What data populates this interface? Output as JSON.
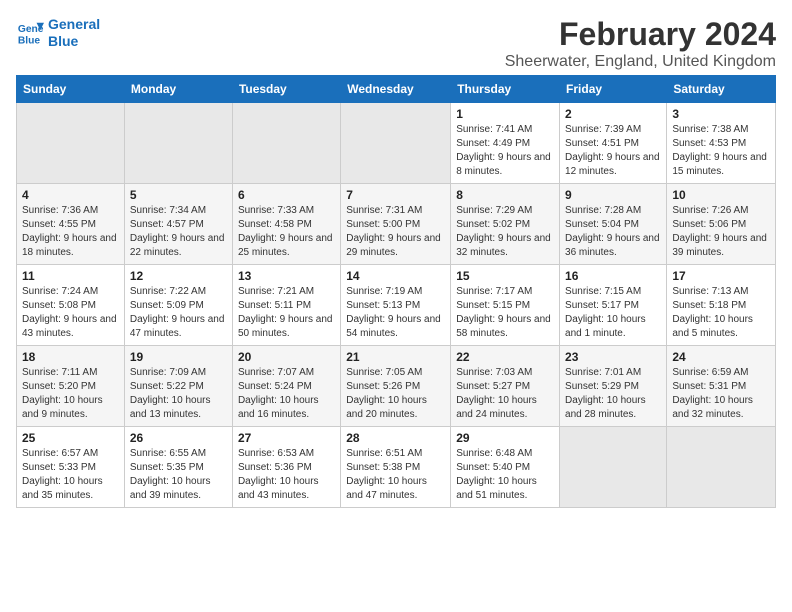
{
  "logo": {
    "line1": "General",
    "line2": "Blue"
  },
  "title": "February 2024",
  "location": "Sheerwater, England, United Kingdom",
  "header": {
    "days": [
      "Sunday",
      "Monday",
      "Tuesday",
      "Wednesday",
      "Thursday",
      "Friday",
      "Saturday"
    ]
  },
  "weeks": [
    [
      {
        "day": "",
        "sunrise": "",
        "sunset": "",
        "daylight": ""
      },
      {
        "day": "",
        "sunrise": "",
        "sunset": "",
        "daylight": ""
      },
      {
        "day": "",
        "sunrise": "",
        "sunset": "",
        "daylight": ""
      },
      {
        "day": "",
        "sunrise": "",
        "sunset": "",
        "daylight": ""
      },
      {
        "day": "1",
        "sunrise": "Sunrise: 7:41 AM",
        "sunset": "Sunset: 4:49 PM",
        "daylight": "Daylight: 9 hours and 8 minutes."
      },
      {
        "day": "2",
        "sunrise": "Sunrise: 7:39 AM",
        "sunset": "Sunset: 4:51 PM",
        "daylight": "Daylight: 9 hours and 12 minutes."
      },
      {
        "day": "3",
        "sunrise": "Sunrise: 7:38 AM",
        "sunset": "Sunset: 4:53 PM",
        "daylight": "Daylight: 9 hours and 15 minutes."
      }
    ],
    [
      {
        "day": "4",
        "sunrise": "Sunrise: 7:36 AM",
        "sunset": "Sunset: 4:55 PM",
        "daylight": "Daylight: 9 hours and 18 minutes."
      },
      {
        "day": "5",
        "sunrise": "Sunrise: 7:34 AM",
        "sunset": "Sunset: 4:57 PM",
        "daylight": "Daylight: 9 hours and 22 minutes."
      },
      {
        "day": "6",
        "sunrise": "Sunrise: 7:33 AM",
        "sunset": "Sunset: 4:58 PM",
        "daylight": "Daylight: 9 hours and 25 minutes."
      },
      {
        "day": "7",
        "sunrise": "Sunrise: 7:31 AM",
        "sunset": "Sunset: 5:00 PM",
        "daylight": "Daylight: 9 hours and 29 minutes."
      },
      {
        "day": "8",
        "sunrise": "Sunrise: 7:29 AM",
        "sunset": "Sunset: 5:02 PM",
        "daylight": "Daylight: 9 hours and 32 minutes."
      },
      {
        "day": "9",
        "sunrise": "Sunrise: 7:28 AM",
        "sunset": "Sunset: 5:04 PM",
        "daylight": "Daylight: 9 hours and 36 minutes."
      },
      {
        "day": "10",
        "sunrise": "Sunrise: 7:26 AM",
        "sunset": "Sunset: 5:06 PM",
        "daylight": "Daylight: 9 hours and 39 minutes."
      }
    ],
    [
      {
        "day": "11",
        "sunrise": "Sunrise: 7:24 AM",
        "sunset": "Sunset: 5:08 PM",
        "daylight": "Daylight: 9 hours and 43 minutes."
      },
      {
        "day": "12",
        "sunrise": "Sunrise: 7:22 AM",
        "sunset": "Sunset: 5:09 PM",
        "daylight": "Daylight: 9 hours and 47 minutes."
      },
      {
        "day": "13",
        "sunrise": "Sunrise: 7:21 AM",
        "sunset": "Sunset: 5:11 PM",
        "daylight": "Daylight: 9 hours and 50 minutes."
      },
      {
        "day": "14",
        "sunrise": "Sunrise: 7:19 AM",
        "sunset": "Sunset: 5:13 PM",
        "daylight": "Daylight: 9 hours and 54 minutes."
      },
      {
        "day": "15",
        "sunrise": "Sunrise: 7:17 AM",
        "sunset": "Sunset: 5:15 PM",
        "daylight": "Daylight: 9 hours and 58 minutes."
      },
      {
        "day": "16",
        "sunrise": "Sunrise: 7:15 AM",
        "sunset": "Sunset: 5:17 PM",
        "daylight": "Daylight: 10 hours and 1 minute."
      },
      {
        "day": "17",
        "sunrise": "Sunrise: 7:13 AM",
        "sunset": "Sunset: 5:18 PM",
        "daylight": "Daylight: 10 hours and 5 minutes."
      }
    ],
    [
      {
        "day": "18",
        "sunrise": "Sunrise: 7:11 AM",
        "sunset": "Sunset: 5:20 PM",
        "daylight": "Daylight: 10 hours and 9 minutes."
      },
      {
        "day": "19",
        "sunrise": "Sunrise: 7:09 AM",
        "sunset": "Sunset: 5:22 PM",
        "daylight": "Daylight: 10 hours and 13 minutes."
      },
      {
        "day": "20",
        "sunrise": "Sunrise: 7:07 AM",
        "sunset": "Sunset: 5:24 PM",
        "daylight": "Daylight: 10 hours and 16 minutes."
      },
      {
        "day": "21",
        "sunrise": "Sunrise: 7:05 AM",
        "sunset": "Sunset: 5:26 PM",
        "daylight": "Daylight: 10 hours and 20 minutes."
      },
      {
        "day": "22",
        "sunrise": "Sunrise: 7:03 AM",
        "sunset": "Sunset: 5:27 PM",
        "daylight": "Daylight: 10 hours and 24 minutes."
      },
      {
        "day": "23",
        "sunrise": "Sunrise: 7:01 AM",
        "sunset": "Sunset: 5:29 PM",
        "daylight": "Daylight: 10 hours and 28 minutes."
      },
      {
        "day": "24",
        "sunrise": "Sunrise: 6:59 AM",
        "sunset": "Sunset: 5:31 PM",
        "daylight": "Daylight: 10 hours and 32 minutes."
      }
    ],
    [
      {
        "day": "25",
        "sunrise": "Sunrise: 6:57 AM",
        "sunset": "Sunset: 5:33 PM",
        "daylight": "Daylight: 10 hours and 35 minutes."
      },
      {
        "day": "26",
        "sunrise": "Sunrise: 6:55 AM",
        "sunset": "Sunset: 5:35 PM",
        "daylight": "Daylight: 10 hours and 39 minutes."
      },
      {
        "day": "27",
        "sunrise": "Sunrise: 6:53 AM",
        "sunset": "Sunset: 5:36 PM",
        "daylight": "Daylight: 10 hours and 43 minutes."
      },
      {
        "day": "28",
        "sunrise": "Sunrise: 6:51 AM",
        "sunset": "Sunset: 5:38 PM",
        "daylight": "Daylight: 10 hours and 47 minutes."
      },
      {
        "day": "29",
        "sunrise": "Sunrise: 6:48 AM",
        "sunset": "Sunset: 5:40 PM",
        "daylight": "Daylight: 10 hours and 51 minutes."
      },
      {
        "day": "",
        "sunrise": "",
        "sunset": "",
        "daylight": ""
      },
      {
        "day": "",
        "sunrise": "",
        "sunset": "",
        "daylight": ""
      }
    ]
  ]
}
